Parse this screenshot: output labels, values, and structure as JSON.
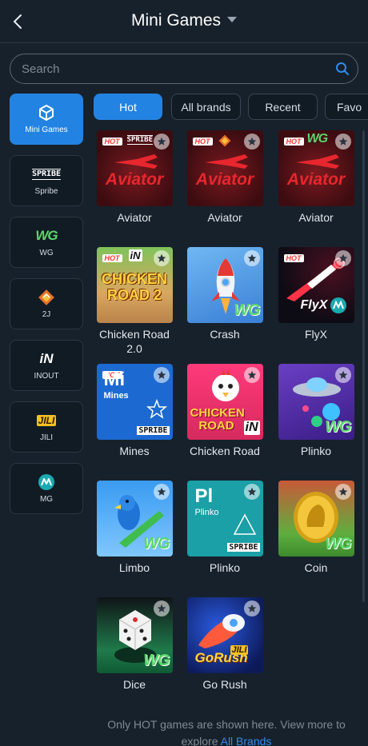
{
  "header": {
    "title": "Mini Games"
  },
  "search": {
    "placeholder": "Search"
  },
  "sidebar": {
    "items": [
      {
        "label": "Mini Games",
        "icon": "cube-icon"
      },
      {
        "label": "Spribe",
        "logo_text": "SPRIBE"
      },
      {
        "label": "WG",
        "logo_text": "WG"
      },
      {
        "label": "2J",
        "logo_text": ""
      },
      {
        "label": "INOUT",
        "logo_text": "iN"
      },
      {
        "label": "JILI",
        "logo_text": "JILI"
      },
      {
        "label": "MG",
        "logo_text": ""
      }
    ]
  },
  "tabs": [
    {
      "label": "Hot"
    },
    {
      "label": "All brands"
    },
    {
      "label": "Recent"
    },
    {
      "label": "Favo"
    }
  ],
  "games": [
    {
      "name": "Aviator",
      "art_text": "Aviator",
      "brand": "SPRIBE",
      "hot": "HOT"
    },
    {
      "name": "Aviator",
      "art_text": "Aviator",
      "brand": "",
      "hot": "HOT"
    },
    {
      "name": "Aviator",
      "art_text": "Aviator",
      "brand": "WG",
      "hot": "HOT"
    },
    {
      "name": "Chicken Road 2.0",
      "art_text": "CHICKEN ROAD 2",
      "brand": "iN",
      "hot": "HOT"
    },
    {
      "name": "Crash",
      "art_text": "",
      "brand": "WG",
      "hot": ""
    },
    {
      "name": "FlyX",
      "art_text": "FlyX",
      "brand": "",
      "hot": "HOT"
    },
    {
      "name": "Mines",
      "art_text": "Mi",
      "art_sub": "Mines",
      "brand": "SPRIBE",
      "hot": "HOT"
    },
    {
      "name": "Chicken Road",
      "art_text": "CHICKEN ROAD",
      "brand": "iN",
      "hot": ""
    },
    {
      "name": "Plinko",
      "art_text": "",
      "brand": "WG",
      "hot": ""
    },
    {
      "name": "Limbo",
      "art_text": "",
      "brand": "WG",
      "hot": ""
    },
    {
      "name": "Plinko",
      "art_text": "Pl",
      "art_sub": "Plinko",
      "brand": "SPRIBE",
      "hot": ""
    },
    {
      "name": "Coin",
      "art_text": "",
      "brand": "WG",
      "hot": ""
    },
    {
      "name": "Dice",
      "art_text": "",
      "brand": "WG",
      "hot": ""
    },
    {
      "name": "Go Rush",
      "art_text": "GoRush",
      "brand": "JILI",
      "hot": ""
    }
  ],
  "footer": {
    "text": "Only HOT games are shown here. View more to explore",
    "link": "All Brands"
  },
  "colors": {
    "accent": "#2383e2",
    "background": "#17212b",
    "link": "#2f8cf0"
  }
}
